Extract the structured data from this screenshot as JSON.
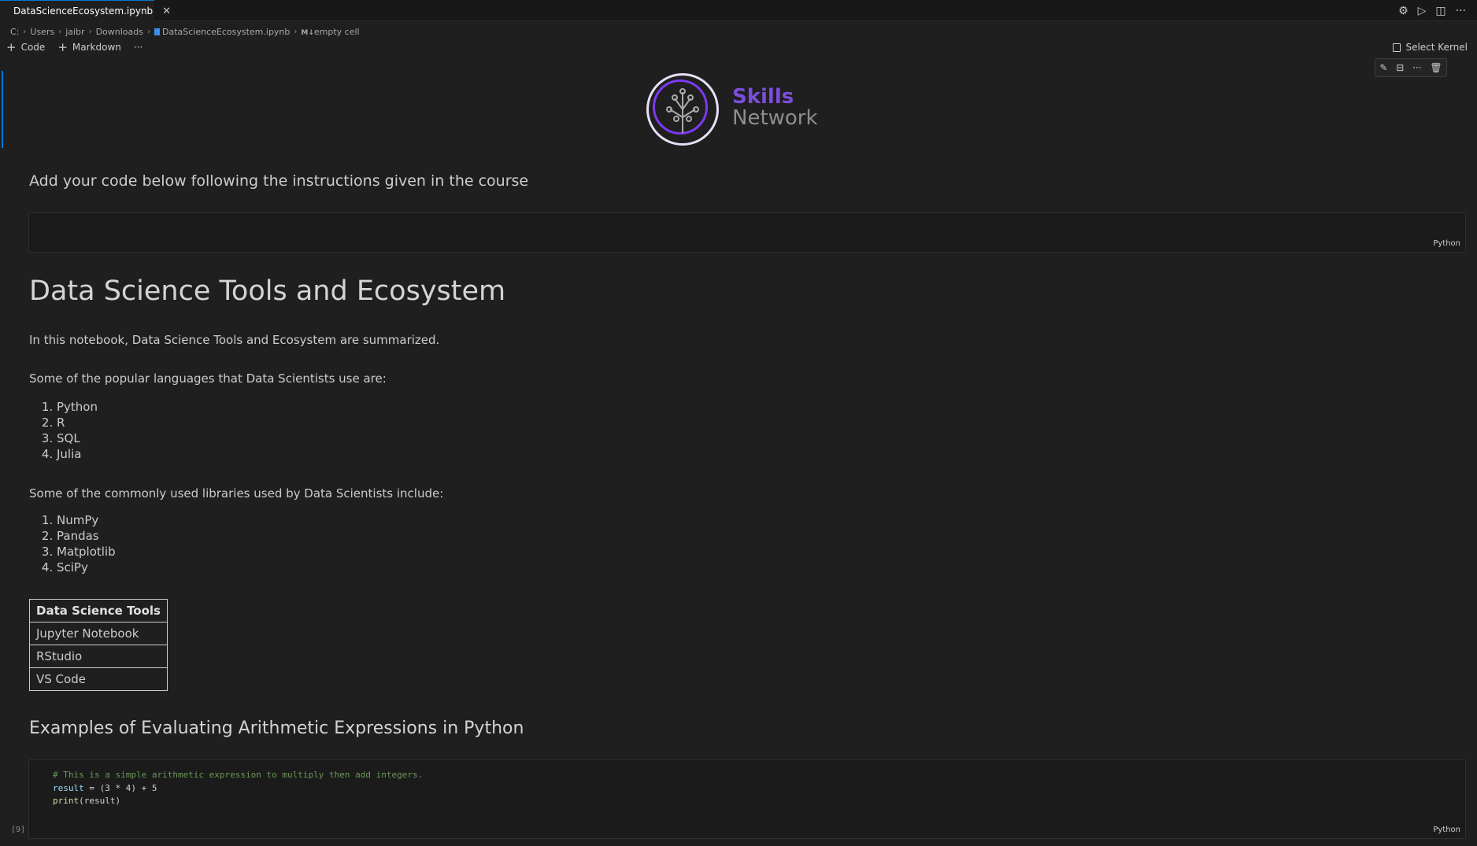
{
  "tab": {
    "title": "DataScienceEcosystem.ipynb",
    "close": "✕"
  },
  "tab_actions": {
    "settings": "⚙",
    "run": "▷",
    "split": "◫",
    "more": "···"
  },
  "breadcrumb": {
    "items": [
      "C:",
      "Users",
      "jaibr",
      "Downloads"
    ],
    "file": "DataScienceEcosystem.ipynb",
    "cell_prefix": "M↓",
    "cell": "empty cell"
  },
  "toolbar": {
    "code_label": "Code",
    "markdown_label": "Markdown",
    "more": "···"
  },
  "kernel": {
    "label": "Select Kernel"
  },
  "cell_toolbar": {
    "edit": "✎",
    "split": "⊟",
    "more": "···",
    "delete": "🗑"
  },
  "logo": {
    "line1": "Skills",
    "line2": "Network"
  },
  "cells": {
    "intro": "Add your code below following the instructions given in the course",
    "empty_lang": "Python",
    "heading": "Data Science Tools and Ecosystem",
    "summary": "In this notebook, Data Science Tools and Ecosystem are summarized.",
    "languages_intro": "Some of the popular languages that Data Scientists use are:",
    "languages": [
      "Python",
      "R",
      "SQL",
      "Julia"
    ],
    "libraries_intro": "Some of the commonly used libraries used by Data Scientists include:",
    "libraries": [
      "NumPy",
      "Pandas",
      "Matplotlib",
      "SciPy"
    ],
    "tools_table": {
      "header": "Data Science Tools",
      "rows": [
        "Jupyter Notebook",
        "RStudio",
        "VS Code"
      ]
    },
    "arith_heading": "Examples of Evaluating Arithmetic Expressions in Python",
    "code": {
      "comment": "# This is a simple arithmetic expression to multiply then add integers.",
      "line2_var": "result",
      "line2_rest": " = (3 * 4) + 5",
      "line3_fn": "print",
      "line3_rest": "(result)",
      "exec_count": "[9]",
      "lang": "Python"
    }
  }
}
